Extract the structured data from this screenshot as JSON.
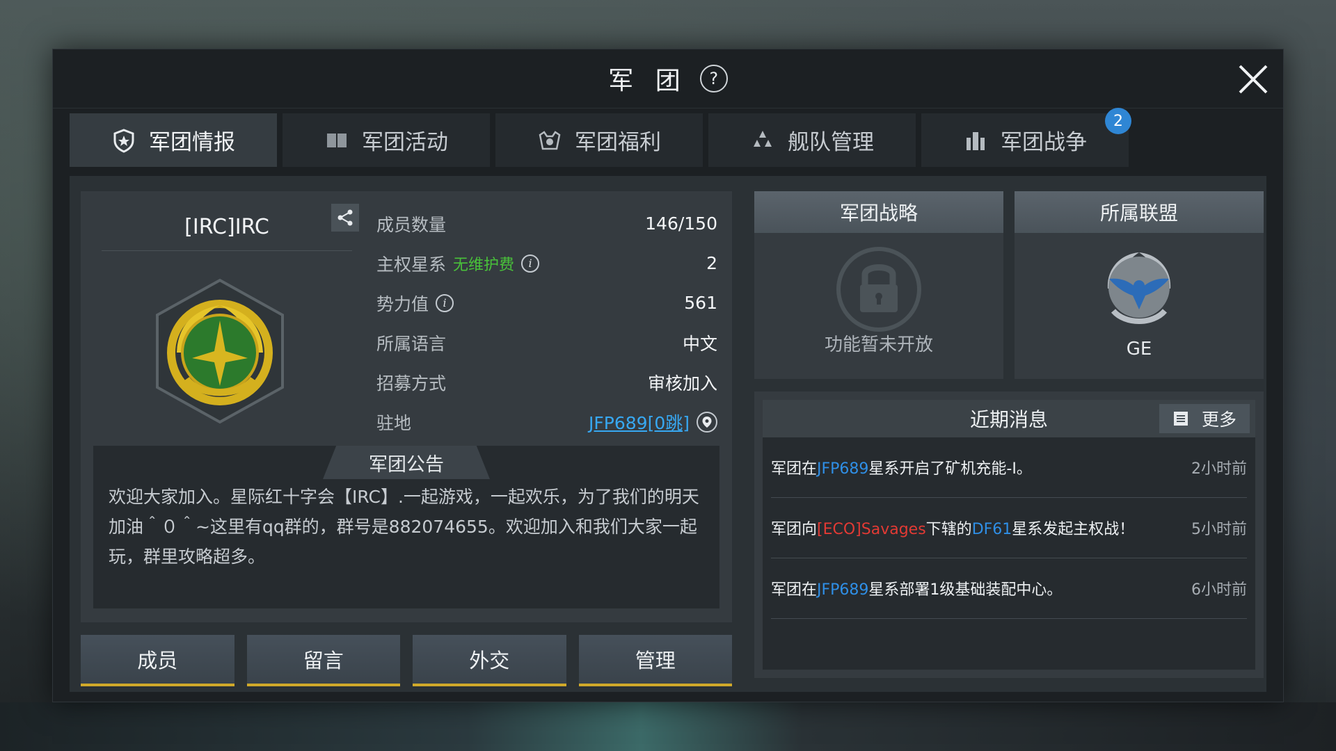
{
  "title": "军 团",
  "help_label": "?",
  "tabs": [
    {
      "label": "军团情报",
      "icon": "shield-icon",
      "active": true
    },
    {
      "label": "军团活动",
      "icon": "book-icon",
      "active": false
    },
    {
      "label": "军团福利",
      "icon": "gift-icon",
      "active": false
    },
    {
      "label": "舰队管理",
      "icon": "fleet-icon",
      "active": false
    },
    {
      "label": "军团战争",
      "icon": "war-icon",
      "active": false,
      "badge": "2"
    }
  ],
  "legion": {
    "name": "[IRC]IRC"
  },
  "stats": [
    {
      "label": "成员数量",
      "value": "146/150"
    },
    {
      "label": "主权星系",
      "note": "无维护费",
      "value": "2"
    },
    {
      "label": "势力值",
      "value": "561"
    },
    {
      "label": "所属语言",
      "value": "中文"
    },
    {
      "label": "招募方式",
      "value": "审核加入"
    },
    {
      "label": "驻地",
      "value": "JFP689[0跳]"
    }
  ],
  "notice": {
    "title": "军团公告",
    "text": "欢迎大家加入。星际红十字会【IRC】.一起游戏，一起欢乐，为了我们的明天加油＾０＾~这里有qq群的，群号是882074655。欢迎加入和我们大家一起玩，群里攻略超多。"
  },
  "buttons": {
    "members": "成员",
    "messages": "留言",
    "diplomacy": "外交",
    "manage": "管理"
  },
  "strategy": {
    "title": "军团战略",
    "locked_text": "功能暂未开放"
  },
  "alliance": {
    "title": "所属联盟",
    "name": "GE"
  },
  "news": {
    "title": "近期消息",
    "more_label": "更多",
    "items": [
      {
        "p1": "军团在",
        "h1": "JFP689",
        "p2": "星系开启了矿机充能-I。",
        "time": "2小时前"
      },
      {
        "p1": "军团向",
        "r1": "[ECO]Savages",
        "p2": "下辖的",
        "h1": "DF61",
        "p3": "星系发起主权战！",
        "time": "5小时前"
      },
      {
        "p1": "军团在",
        "h1": "JFP689",
        "p2": "星系部署1级基础装配中心。",
        "time": "6小时前"
      }
    ]
  },
  "colors": {
    "accent_gold": "#d0a92a",
    "badge_blue": "#2f86d4",
    "link_blue": "#37a8f2",
    "note_green": "#49c23a",
    "enemy_red": "#e23a34"
  }
}
